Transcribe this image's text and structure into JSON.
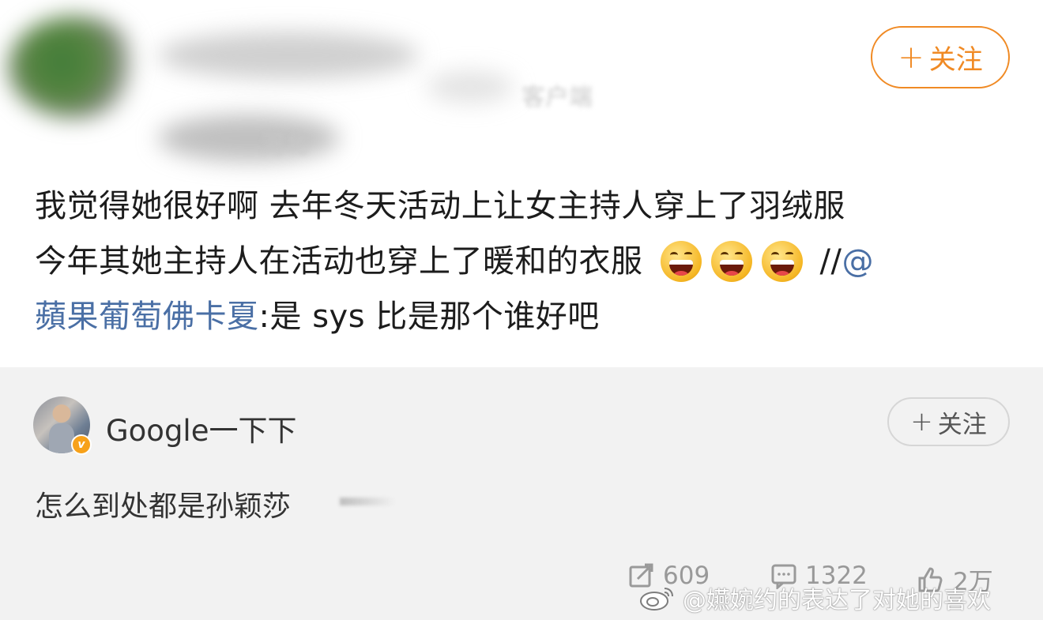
{
  "post": {
    "follow_plus": "+",
    "follow_label": "关注",
    "blurred_client": "客户端",
    "blurred_region": "河北",
    "lines": [
      "我觉得她很好啊 去年冬天活动上让女主持人穿上了羽绒服",
      "今年其她主持人在活动也穿上了暖和的衣服",
      ":是 sys 比是那个谁好吧"
    ],
    "slashes": "//",
    "mention_at": "@",
    "mention_name": "蘋果葡萄佛卡夏",
    "emoji_name": "laughing-emoji"
  },
  "comment": {
    "author": "Google一下下",
    "verified_badge": "v",
    "follow_plus": "+",
    "follow_label": "关注",
    "text": "怎么到处都是孙颖莎",
    "stats": {
      "reposts": "609",
      "comments": "1322",
      "likes": "2万"
    }
  },
  "watermark": {
    "text": "@嬿婉约的表达了对她的喜欢",
    "logo_icon": "weibo-logo-icon"
  },
  "colors": {
    "accent_orange": "#f08a24",
    "mention_blue": "#4a6fa5",
    "comment_bg": "#f2f2f2",
    "stat_gray": "#999999"
  }
}
